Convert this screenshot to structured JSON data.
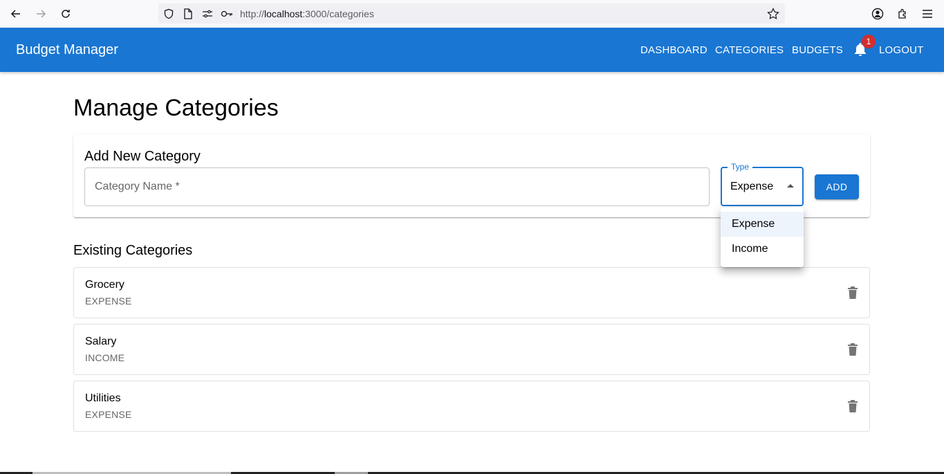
{
  "browser": {
    "url_prefix": "http://",
    "url_host": "localhost",
    "url_rest": ":3000/categories"
  },
  "appbar": {
    "title": "Budget Manager",
    "nav": [
      "DASHBOARD",
      "CATEGORIES",
      "BUDGETS"
    ],
    "notification_count": "1",
    "logout": "LOGOUT",
    "color": "#1976d2"
  },
  "page": {
    "title": "Manage Categories"
  },
  "add_form": {
    "title": "Add New Category",
    "name_placeholder": "Category Name *",
    "type_label": "Type",
    "type_value": "Expense",
    "add_label": "ADD",
    "options": [
      "Expense",
      "Income"
    ]
  },
  "existing": {
    "title": "Existing Categories",
    "items": [
      {
        "name": "Grocery",
        "type": "EXPENSE"
      },
      {
        "name": "Salary",
        "type": "INCOME"
      },
      {
        "name": "Utilities",
        "type": "EXPENSE"
      }
    ]
  },
  "icons": [
    "back-icon",
    "forward-icon",
    "reload-icon",
    "shield-icon",
    "page-icon",
    "permissions-icon",
    "key-icon",
    "star-icon",
    "account-icon",
    "extensions-icon",
    "menu-icon",
    "bell-icon",
    "trash-icon"
  ]
}
